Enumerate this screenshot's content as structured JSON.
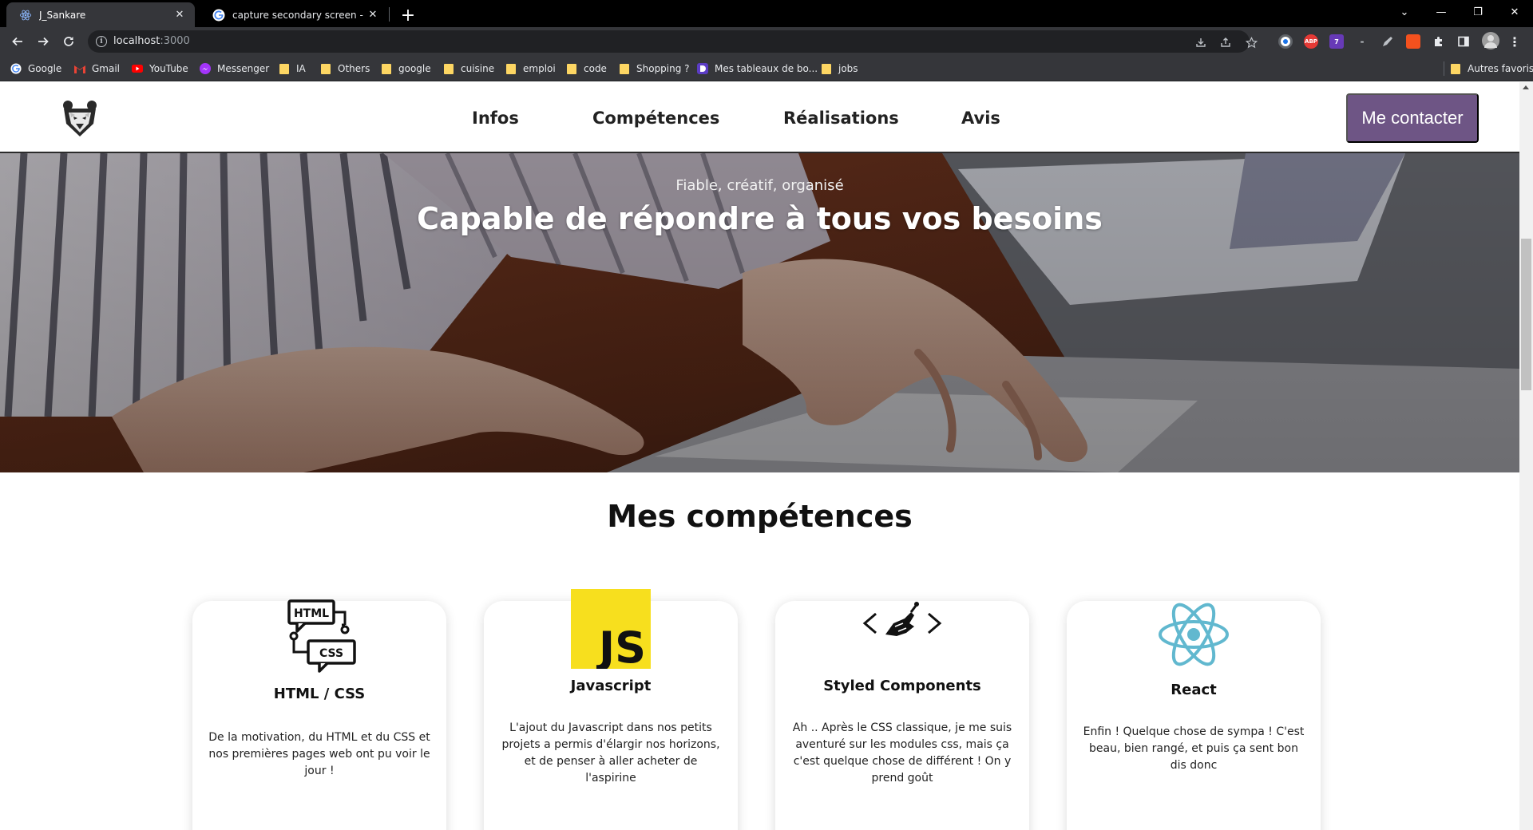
{
  "browser": {
    "tabs": [
      {
        "title": "J_Sankare",
        "active": true,
        "favicon": "react-icon"
      },
      {
        "title": "capture secondary screen - Google",
        "active": false,
        "favicon": "google-icon"
      }
    ],
    "new_tab": "+",
    "url_host": "localhost",
    "url_port": ":3000",
    "window_controls": {
      "chevron": "⌄",
      "minimize": "—",
      "restore": "❐",
      "close": "✕"
    },
    "bookmarks": [
      {
        "label": "Google",
        "icon": "google-icon"
      },
      {
        "label": "Gmail",
        "icon": "gmail-icon"
      },
      {
        "label": "YouTube",
        "icon": "youtube-icon"
      },
      {
        "label": "Messenger",
        "icon": "messenger-icon"
      },
      {
        "label": "IA",
        "icon": "folder-icon"
      },
      {
        "label": "Others",
        "icon": "folder-icon"
      },
      {
        "label": "google",
        "icon": "folder-icon"
      },
      {
        "label": "cuisine",
        "icon": "folder-icon"
      },
      {
        "label": "emploi",
        "icon": "folder-icon"
      },
      {
        "label": "code",
        "icon": "folder-icon"
      },
      {
        "label": "Shopping ?",
        "icon": "folder-icon"
      },
      {
        "label": "Mes tableaux de bo...",
        "icon": "dashboard-icon"
      },
      {
        "label": "jobs",
        "icon": "folder-icon"
      }
    ],
    "other_bookmarks": "Autres favoris",
    "extension_badges": {
      "abp": "ABP",
      "counter": "7"
    },
    "colors": {
      "tabstrip": "#000000",
      "toolbar": "#35363a",
      "omnibox": "#202124"
    }
  },
  "site": {
    "nav": {
      "links": [
        "Infos",
        "Compétences",
        "Réalisations",
        "Avis"
      ],
      "contact_label": "Me contacter"
    },
    "hero": {
      "subtitle": "Fiable, créatif, organisé",
      "title": "Capable de répondre à tous vos besoins"
    },
    "skills": {
      "title": "Mes compétences",
      "cards": [
        {
          "title": "HTML / CSS",
          "text": "De la motivation, du HTML et du CSS et nos premières pages web ont pu voir le jour !",
          "icon": "html-css-icon",
          "badge": [
            "HTML",
            "CSS"
          ]
        },
        {
          "title": "Javascript",
          "text": "L'ajout du Javascript dans nos petits projets a permis d'élargir nos horizons, et de penser à aller acheter de l'aspirine",
          "icon": "javascript-icon",
          "badge": [
            "JS"
          ]
        },
        {
          "title": "Styled Components",
          "text": "Ah .. Après le CSS classique, je me suis aventuré sur les modules css, mais ça c'est quelque chose de différent ! On y prend goût",
          "icon": "styled-components-icon"
        },
        {
          "title": "React",
          "text": "Enfin ! Quelque chose de sympa ! C'est beau, bien rangé, et puis ça sent bon dis donc",
          "icon": "react-icon"
        }
      ]
    },
    "colors": {
      "accent": "#6e5585",
      "js_yellow": "#f7df1e",
      "react_blue": "#61b8cf"
    }
  }
}
